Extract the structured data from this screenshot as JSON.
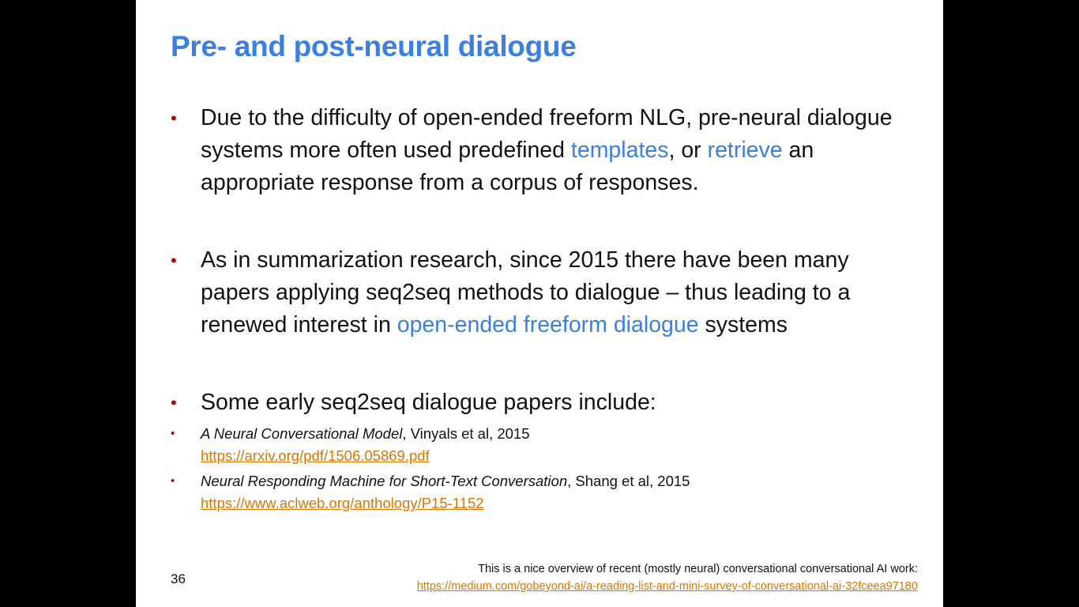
{
  "slide": {
    "title": "Pre- and post-neural dialogue",
    "bullets": [
      {
        "parts": [
          "Due to the difficulty of open-ended freeform NLG, pre-neural dialogue systems more often used predefined ",
          "templates",
          ", or ",
          "retrieve",
          " an appropriate response from a corpus of responses."
        ]
      },
      {
        "parts": [
          "As in summarization research, since 2015 there have been many papers applying seq2seq methods to dialogue – thus leading to a renewed interest in ",
          "open-ended freeform dialogue",
          " systems"
        ]
      },
      {
        "text": "Some early seq2seq dialogue papers include:"
      }
    ],
    "papers": [
      {
        "title": "A Neural Conversational Model",
        "authors": ", Vinyals et al, 2015",
        "url": "https://arxiv.org/pdf/1506.05869.pdf"
      },
      {
        "title": "Neural Responding Machine for Short-Text Conversation",
        "authors": ", Shang et al, 2015",
        "url": "https://www.aclweb.org/anthology/P15-1152"
      }
    ],
    "slide_number": "36",
    "footer": {
      "note": "This is a nice overview of recent (mostly neural) conversational conversational AI work:",
      "url": "https://medium.com/gobeyond-ai/a-reading-list-and-mini-survey-of-conversational-ai-32fceea97180"
    },
    "colors": {
      "title": "#3b7fe0",
      "highlight": "#3b7fe0",
      "bullet": "#c00000",
      "link": "#d97600",
      "background": "#000000"
    }
  }
}
